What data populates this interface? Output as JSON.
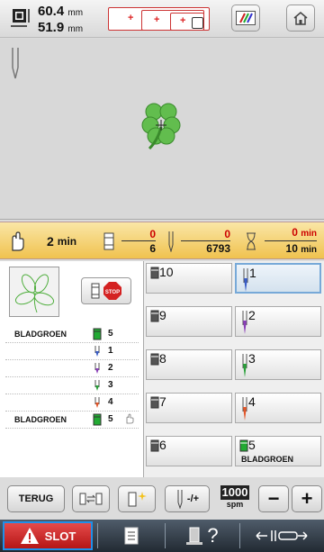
{
  "header": {
    "width_value": "60.4",
    "height_value": "51.9",
    "unit": "mm"
  },
  "status": {
    "time_value": "2",
    "time_unit": "min",
    "color_current": "0",
    "color_total": "6",
    "stitch_current": "0",
    "stitch_total": "6793",
    "remaining_current": "0",
    "remaining_total": "10",
    "remaining_unit": "min"
  },
  "thread_list": {
    "rows": [
      {
        "name": "BLADGROEN",
        "number": "5",
        "color": "#22aa33"
      },
      {
        "name": "",
        "number": "1",
        "color": "#3a5ec8"
      },
      {
        "name": "",
        "number": "2",
        "color": "#8a3fb8"
      },
      {
        "name": "",
        "number": "3",
        "color": "#2aa03a"
      },
      {
        "name": "",
        "number": "4",
        "color": "#e2572a"
      },
      {
        "name": "BLADGROEN",
        "number": "5",
        "color": "#22aa33"
      }
    ]
  },
  "needle_grid": {
    "cells": [
      {
        "number": "10",
        "label": ""
      },
      {
        "number": "1",
        "label": ""
      },
      {
        "number": "9",
        "label": ""
      },
      {
        "number": "2",
        "label": ""
      },
      {
        "number": "8",
        "label": ""
      },
      {
        "number": "3",
        "label": ""
      },
      {
        "number": "7",
        "label": ""
      },
      {
        "number": "4",
        "label": ""
      },
      {
        "number": "6",
        "label": ""
      },
      {
        "number": "5",
        "label": "BLADGROEN"
      }
    ]
  },
  "bottom": {
    "back_label": "TERUG",
    "speed_value": "1000",
    "speed_unit": "spm",
    "minus": "−",
    "plus": "+",
    "needle_adj": "-/+"
  },
  "footer": {
    "slot_label": "SLOT",
    "help": "?"
  },
  "colors": {
    "accent_blue": "#1f8fe8",
    "slot_red": "#cf2a2a",
    "clover_green": "#5fb84a",
    "status_orange": "#f0c24f"
  }
}
